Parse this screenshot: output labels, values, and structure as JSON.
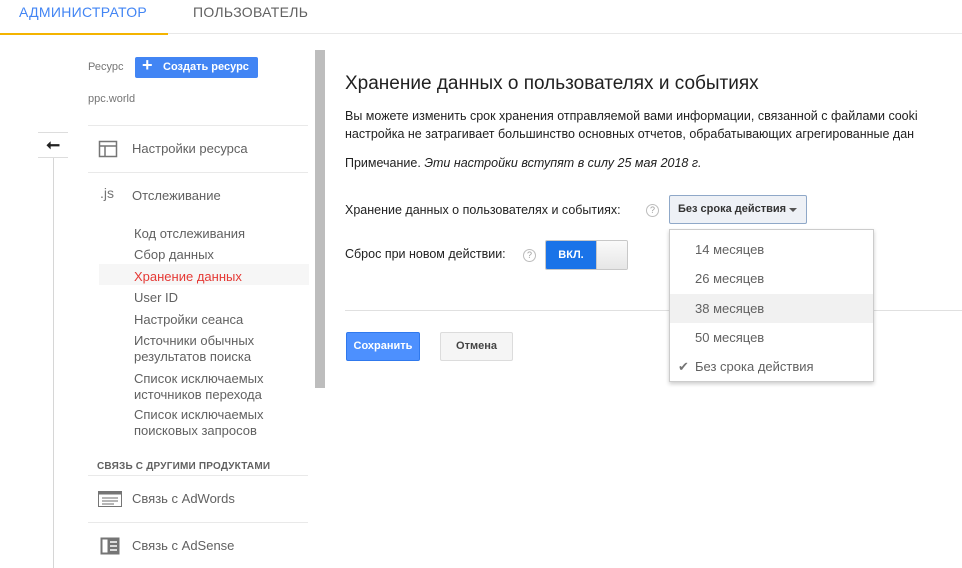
{
  "tabs": {
    "admin": "АДМИНИСТРАТОР",
    "user": "ПОЛЬЗОВАТЕЛЬ"
  },
  "sidebar": {
    "resource_label": "Ресурс",
    "create_button": "Создать ресурс",
    "resource_name": "ppc.world",
    "items": [
      {
        "label": "Настройки ресурса",
        "icon": "property-settings-icon"
      },
      {
        "label": "Отслеживание",
        "icon": "js-icon"
      }
    ],
    "tracking_sub": [
      {
        "label": "Код отслеживания"
      },
      {
        "label": "Сбор данных"
      },
      {
        "label": "Хранение данных",
        "active": true
      },
      {
        "label": "User ID"
      },
      {
        "label": "Настройки сеанса"
      },
      {
        "label": "Источники обычных результатов поиска"
      },
      {
        "label": "Список исключаемых источников перехода"
      },
      {
        "label": "Список исключаемых поисковых запросов"
      }
    ],
    "section_title": "СВЯЗЬ С ДРУГИМИ ПРОДУКТАМИ",
    "links": [
      {
        "label": "Связь с AdWords",
        "icon": "adwords-icon"
      },
      {
        "label": "Связь с AdSense",
        "icon": "adsense-icon"
      }
    ]
  },
  "main": {
    "title": "Хранение данных о пользователях и событиях",
    "description_line1": "Вы можете изменить срок хранения отправляемой вами информации, связанной с файлами cooki",
    "description_line2": "настройка не затрагивает большинство основных отчетов, обрабатывающих агрегированные дан",
    "note_label": "Примечание.",
    "note_text": "Эти настройки вступят в силу 25 мая 2018 г.",
    "retention_label": "Хранение данных о пользователях и событиях:",
    "retention_value": "Без срока действия",
    "reset_label": "Сброс при новом действии:",
    "reset_toggle": "ВКЛ.",
    "save_button": "Сохранить",
    "cancel_button": "Отмена"
  },
  "dropdown": {
    "options": [
      "14 месяцев",
      "26 месяцев",
      "38 месяцев",
      "50 месяцев",
      "Без срока действия"
    ],
    "hovered": "38 месяцев",
    "selected": "Без срока действия"
  },
  "colors": {
    "accent": "#4285f4",
    "tab_underline": "#f4b400",
    "active_item": "#e53935",
    "toggle_on": "#1a73e8"
  }
}
